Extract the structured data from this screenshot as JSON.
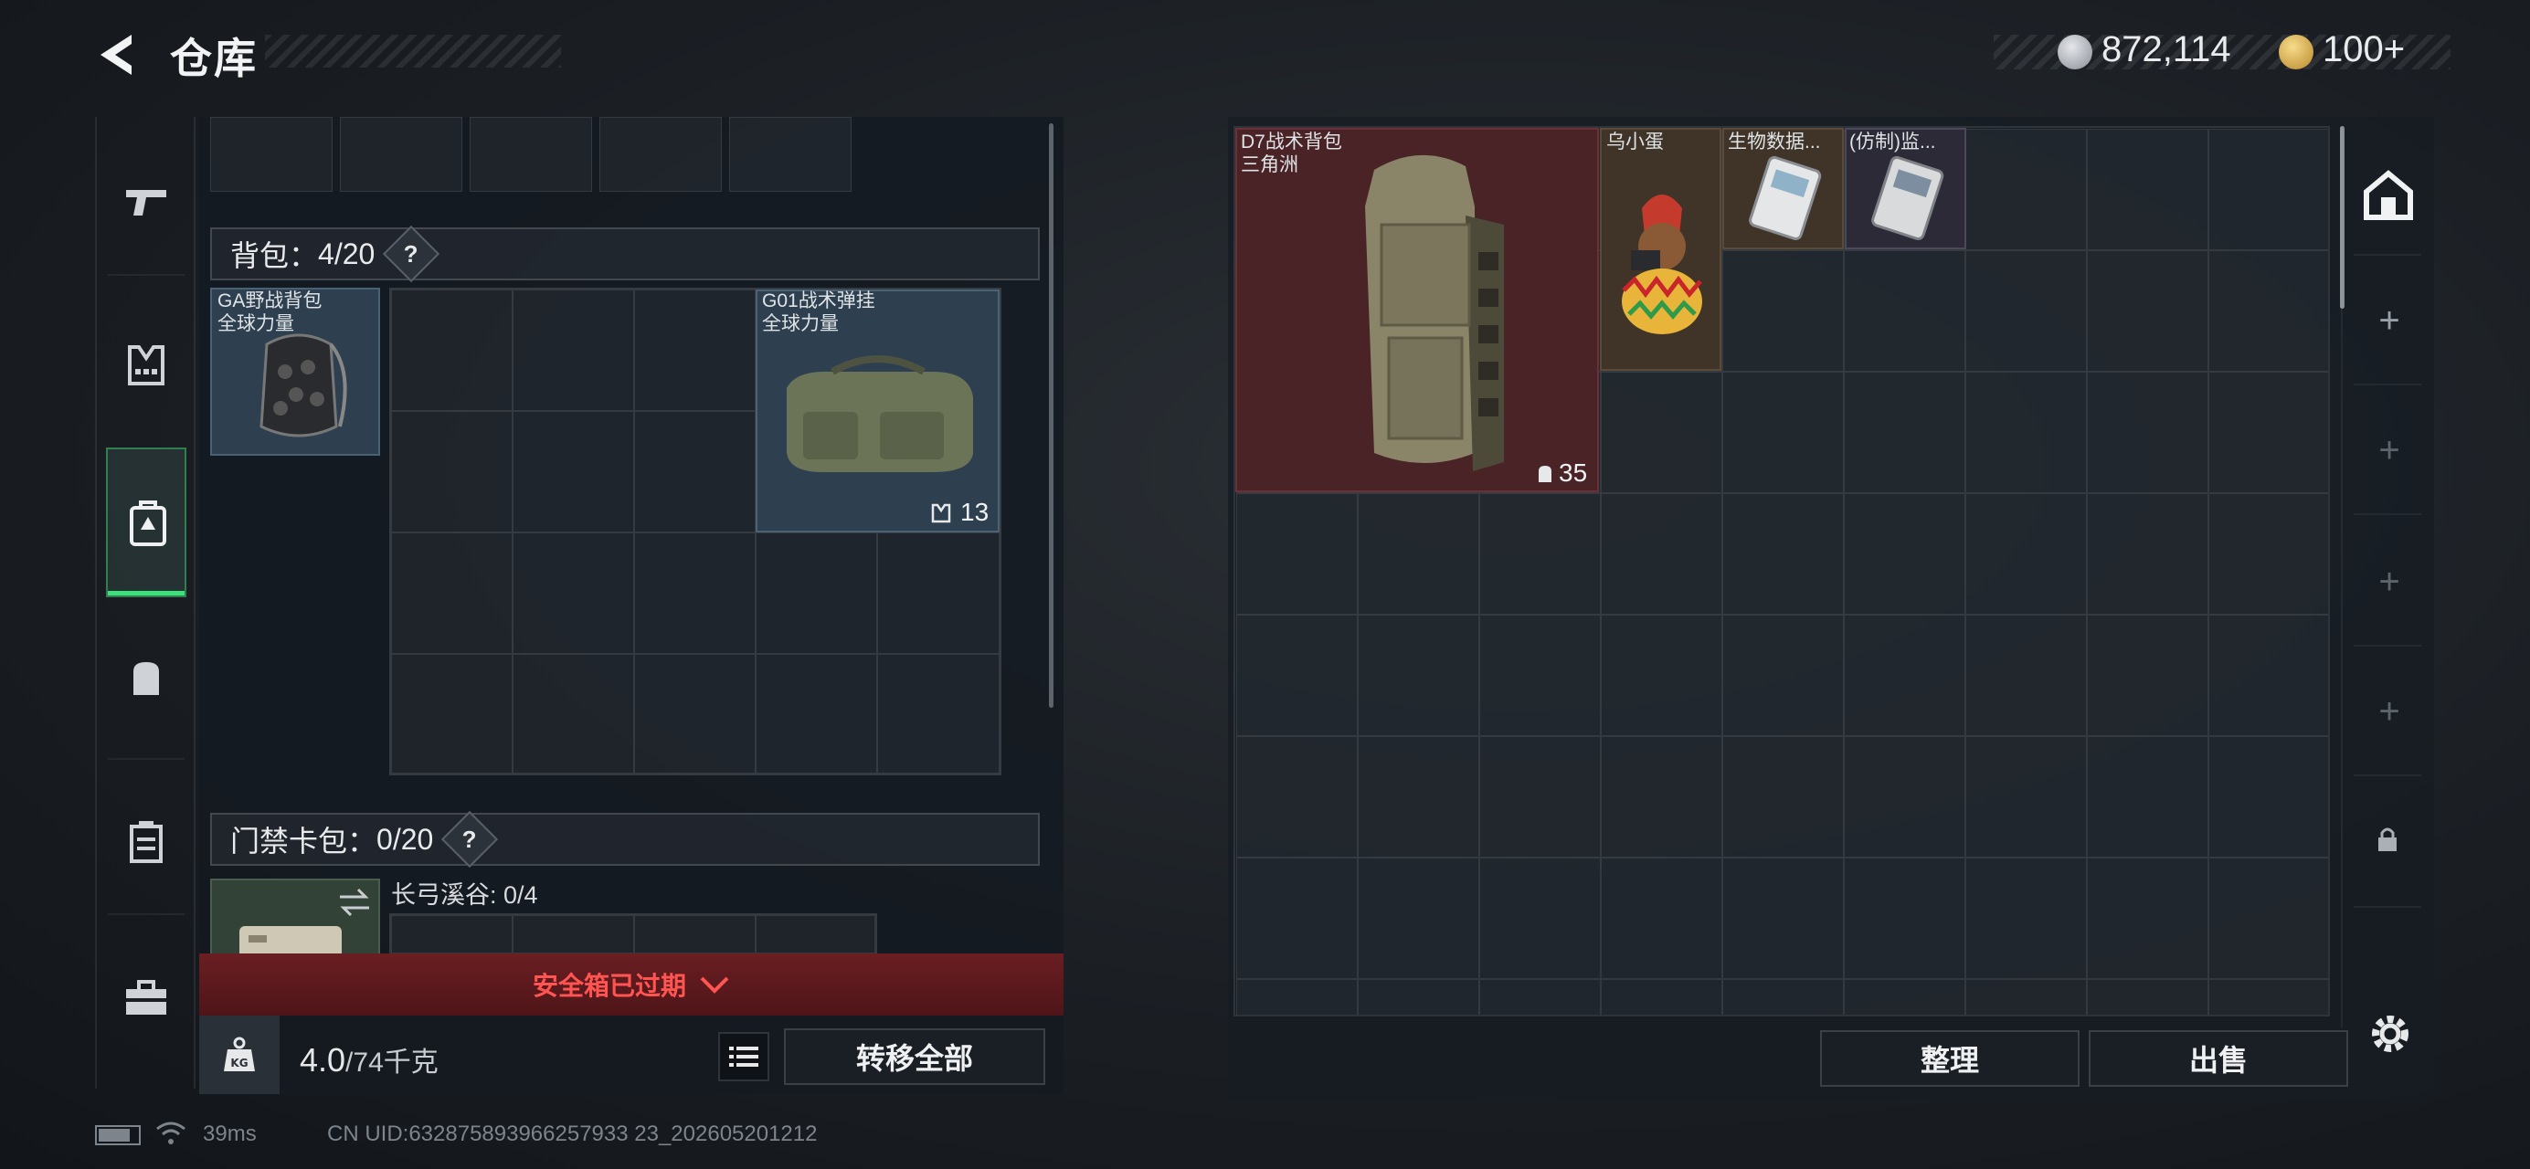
{
  "header": {
    "title": "仓库",
    "currency1": "872,114",
    "currency2": "100+"
  },
  "sidebar": {
    "items": [
      "weapon-tab",
      "armor-tab",
      "backpack-tab",
      "chest-rig-tab",
      "case-tab",
      "toolbox-tab"
    ],
    "active": "backpack-tab"
  },
  "left_panel": {
    "backpack_section": {
      "label": "背包：",
      "count": "4/20",
      "help": "?"
    },
    "backpack_items": [
      {
        "name": "GA野战背包",
        "sub": "全球力量"
      },
      {
        "name": "G01战术弹挂",
        "sub": "全球力量",
        "badge": "13"
      }
    ],
    "keycard_section": {
      "label": "门禁卡包：",
      "count": "0/20",
      "help": "?"
    },
    "keycard_map": "长弓溪谷: 0/4",
    "safe_box_status": "安全箱已过期",
    "weight": {
      "current": "4.0",
      "max": "/74千克"
    },
    "transfer_all": "转移全部"
  },
  "stash": {
    "items": [
      {
        "name": "D7战术背包",
        "sub": "三角洲",
        "badge": "35"
      },
      {
        "name": "乌小蛋"
      },
      {
        "name": "生物数据..."
      },
      {
        "name": "(仿制)监..."
      }
    ],
    "sort_button": "整理",
    "sell_button": "出售"
  },
  "status_bar": {
    "ping": "39ms",
    "uid": "CN UID:632875893966257933 23_202605201212"
  },
  "colors": {
    "accent_green": "#3ee07c",
    "expired_red": "#ff5552",
    "item_red_bg": "#4a2327",
    "item_blue_bg": "#2e4050",
    "item_brown_bg": "#3f3427",
    "item_purple_bg": "#2b2a36"
  }
}
